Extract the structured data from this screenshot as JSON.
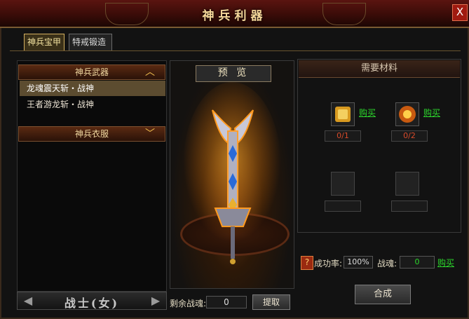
{
  "window": {
    "title": "神兵利器",
    "close_label": "X"
  },
  "tabs": [
    {
      "label": "神兵宝甲",
      "active": true
    },
    {
      "label": "特戒锻造",
      "active": false
    }
  ],
  "categories": [
    {
      "label": "神兵武器",
      "expanded": true,
      "items": [
        "龙魂震天斩・战神",
        "王者游龙斩・战神"
      ]
    },
    {
      "label": "神兵衣服",
      "expanded": false,
      "items": []
    }
  ],
  "class_selector": {
    "label": "战士(女)"
  },
  "preview": {
    "title": "预 览"
  },
  "remaining": {
    "label": "剩余战魂:",
    "value": "0",
    "extract_label": "提取"
  },
  "materials": {
    "title": "需要材料",
    "slots": [
      {
        "icon": "scroll-icon",
        "buy_label": "购买",
        "count": "0/1"
      },
      {
        "icon": "orb-icon",
        "buy_label": "购买",
        "count": "0/2"
      },
      {
        "icon": "",
        "buy_label": "",
        "count": ""
      },
      {
        "icon": "",
        "buy_label": "",
        "count": ""
      }
    ]
  },
  "success": {
    "label": "成功率:",
    "value": "100%"
  },
  "soul": {
    "label": "战魂:",
    "value": "0",
    "buy_label": "购买"
  },
  "compose_label": "合成",
  "colors": {
    "accent_gold": "#f4d79a",
    "buy_green": "#2cd62c",
    "count_red": "#d84a2a",
    "title_red": "#5a1410"
  }
}
